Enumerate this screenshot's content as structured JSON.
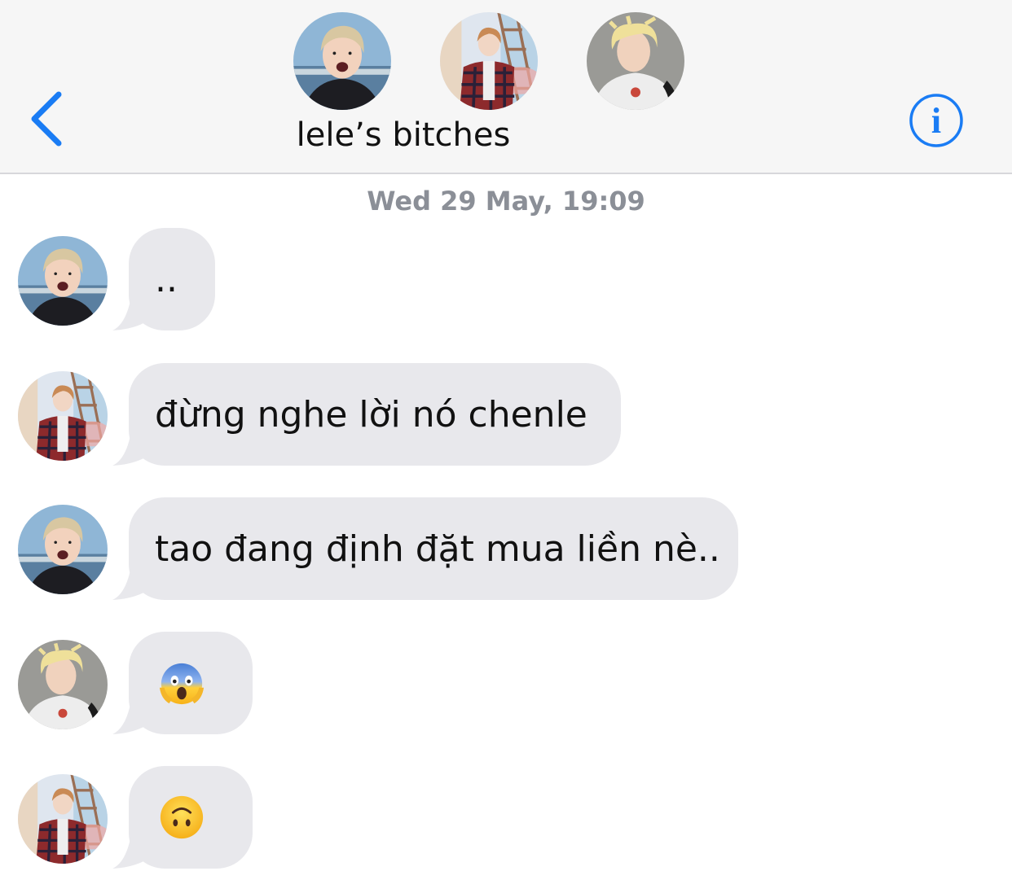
{
  "header": {
    "group_name": "lele’s bitches",
    "back_icon": "chevron-left-icon",
    "info_icon": "info-icon",
    "accent_color": "#1a7cf4",
    "members": [
      "member-1",
      "member-2",
      "member-3"
    ]
  },
  "conversation": {
    "timestamp": "Wed 29 May, 19:09",
    "messages": [
      {
        "sender": "member-1",
        "text": ".."
      },
      {
        "sender": "member-2",
        "text": "đừng nghe lời nó chenle"
      },
      {
        "sender": "member-1",
        "text": "tao đang định đặt mua liền nè.."
      },
      {
        "sender": "member-3",
        "text": "",
        "emoji": "face-screaming-in-fear-emoji"
      },
      {
        "sender": "member-2",
        "text": "",
        "emoji": "upside-down-face-emoji"
      }
    ]
  }
}
